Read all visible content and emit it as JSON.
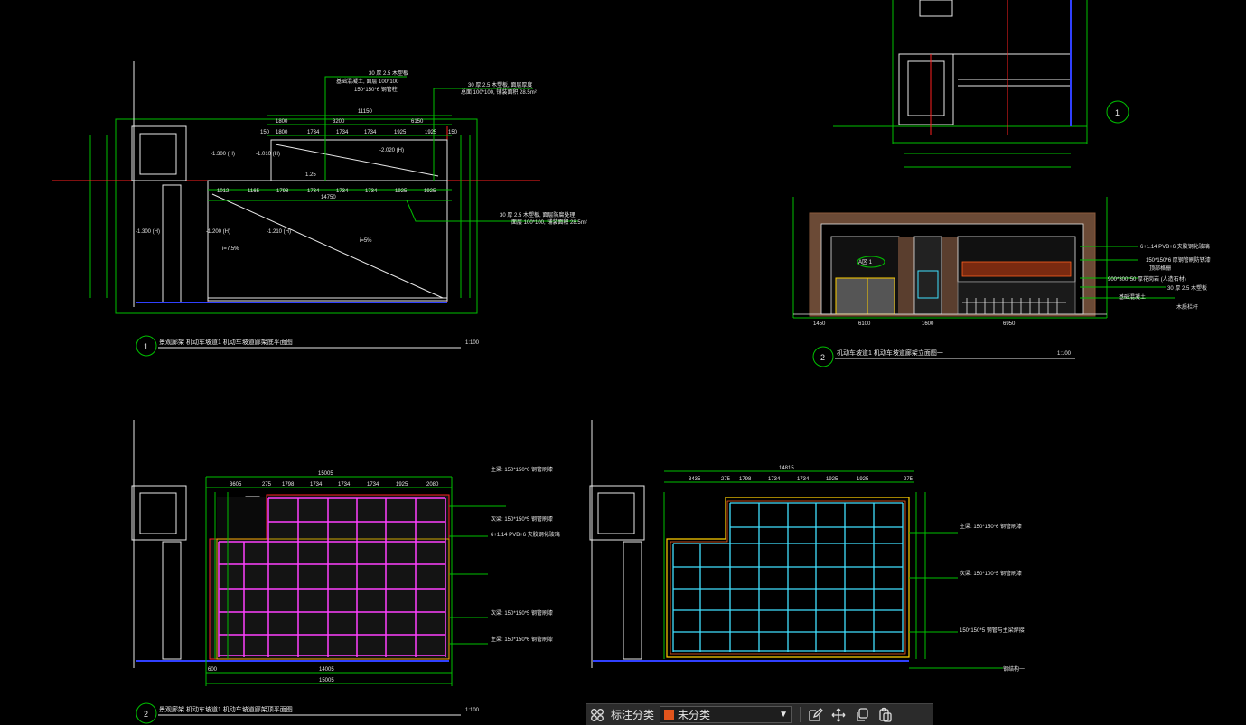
{
  "drawing": {
    "colors": {
      "bg": "#000000",
      "green": "#00c000",
      "white": "#e8e8e8",
      "red": "#ff2020",
      "magenta": "#ff40ff",
      "cyan": "#40e0ff",
      "yellow": "#ffd000",
      "blue": "#3040ff",
      "brown": "#8b5a3c"
    },
    "titles": {
      "t1": "1",
      "t1_text": "景观廊架 机动车坡道1 机动车坡道廊架底平面图",
      "t1_scale": "1:100",
      "t2": "2",
      "t2_text": "机动车坡道1 机动车坡道廊架立面图一",
      "t2_scale": "1:100",
      "t3": "2",
      "t3_text": "景观廊架 机动车坡道1 机动车坡道廊架顶平面图",
      "t3_scale": "1:100",
      "t4": "1"
    },
    "dims_top": {
      "overall": "11150",
      "a": "1800",
      "b": "3200",
      "c": "6150",
      "d": "150",
      "e": "1800",
      "f": "1734",
      "g": "1734",
      "h": "1734",
      "i": "1925",
      "j": "1925",
      "k": "150"
    },
    "dims_mid": {
      "overall": "14750",
      "a": "1012",
      "b": "1165",
      "c": "1798",
      "d": "1734",
      "e": "1734",
      "f": "1734",
      "g": "1925",
      "h": "1925"
    },
    "levels": {
      "l1": "-1.300 (H)",
      "l2": "-1.010 (H)",
      "l3": "-2.020 (H)",
      "l4": "-1.300 (H)",
      "l5": "-1.200 (H)",
      "l6": "-1.210 (H)"
    },
    "slopes": {
      "s1": "i=7.5%",
      "s2": "i=5%",
      "s3": "1.25"
    },
    "elev_dims": {
      "a": "1450",
      "b": "6100",
      "c": "1600",
      "d": "6950"
    },
    "elev_notes": [
      "6+1.14 PVB+6 夹胶钢化玻璃",
      "150*150*6 厚钢管刷防锈漆",
      "顶部格栅",
      "900*300*50 厚花岗岩 (人造石材)",
      "30 厚 2.5 木塑板",
      "基础混凝土",
      "木质栏杆"
    ],
    "mark": "A区 1",
    "roof_dims": {
      "overall": "15005",
      "a": "3605",
      "b": "275",
      "c": "1798",
      "d": "1734",
      "e": "1734",
      "f": "1734",
      "g": "1925",
      "h": "2080",
      "bottom1": "14005",
      "bottom2": "15005",
      "left": "600"
    },
    "roof2_dims": {
      "overall": "14815",
      "a": "3435",
      "b": "275",
      "c": "1798",
      "d": "1734",
      "e": "1734",
      "f": "1925",
      "g": "1925",
      "h": "275"
    },
    "roof_notes": [
      "主梁: 150*150*6 钢管刷漆",
      "次梁: 150*150*5 钢管刷漆",
      "6+1.14 PVB+6 夹胶钢化玻璃",
      "次梁: 150*150*5 钢管刷漆",
      "主梁: 150*150*6 钢管刷漆"
    ],
    "roof2_notes": [
      "主梁: 150*150*6 钢管刷漆",
      "次梁: 150*100*5 钢管刷漆",
      "150*150*5 钢管与主梁焊接",
      "钢结构一"
    ],
    "notes_top": [
      "30 厚 2.5 木塑板",
      "基础混凝土, 面层 100*100",
      "150*150*6 钢管柱",
      "30 厚 2.5 木塑板, 面层厚度",
      "总面 100*100, 铺装面积 28.5m²"
    ],
    "notes_right": [
      "30 厚 2.5 木塑板, 面层防腐处理",
      "面层 100*100, 铺装面积 28.5m²"
    ]
  },
  "toolbar": {
    "grid_icon": "grid-icon",
    "label": "标注分类",
    "select_value": "未分类",
    "swatch_color": "#e0541c",
    "icons": [
      "edit-icon",
      "move-icon",
      "copy-icon",
      "paste-icon"
    ]
  }
}
